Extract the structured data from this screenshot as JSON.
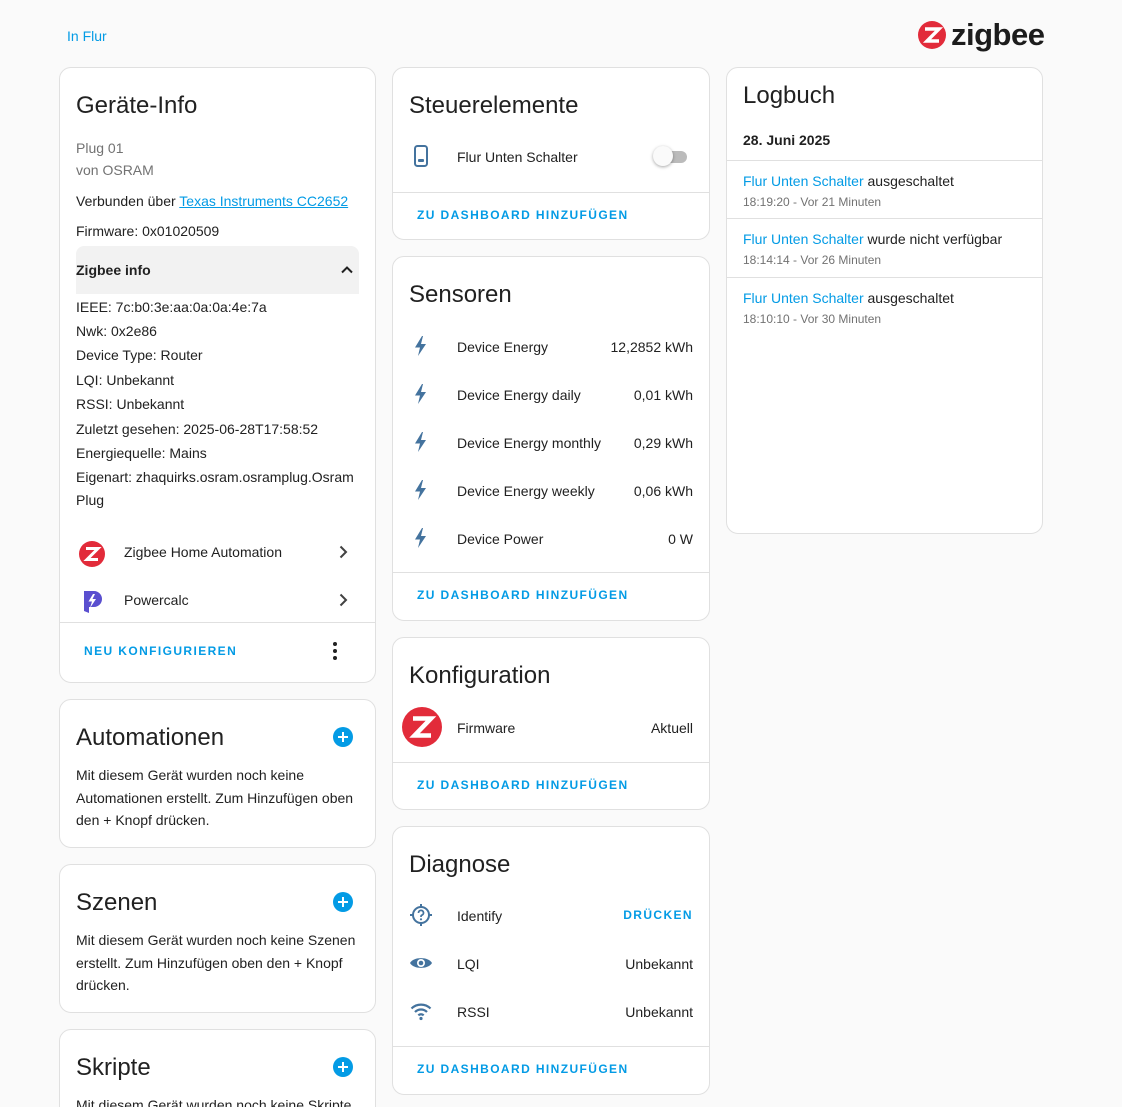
{
  "breadcrumb": {
    "area": "In Flur"
  },
  "brand": {
    "name": "zigbee",
    "color": "#e22b3a"
  },
  "device_info": {
    "title": "Geräte-Info",
    "model": "Plug 01",
    "manufacturer": "von OSRAM",
    "connected_prefix": "Verbunden über ",
    "connected_via": "Texas Instruments CC2652",
    "firmware": "Firmware: 0x01020509",
    "zigbee_info_title": "Zigbee info",
    "zigbee_lines": [
      "IEEE: 7c:b0:3e:aa:0a:0a:4e:7a",
      "Nwk: 0x2e86",
      "Device Type: Router",
      "LQI: Unbekannt",
      "RSSI: Unbekannt",
      "Zuletzt gesehen: 2025-06-28T17:58:52",
      "Energiequelle: Mains",
      "Eigenart: zhaquirks.osram.osramplug.Osram Plug"
    ],
    "integrations": [
      {
        "label": "Zigbee Home Automation",
        "icon": "zigbee-logo-icon"
      },
      {
        "label": "Powercalc",
        "icon": "powercalc-logo-icon"
      }
    ],
    "reconfigure_label": "NEU KONFIGURIEREN"
  },
  "automations": {
    "title": "Automationen",
    "text": "Mit diesem Gerät wurden noch keine Automationen erstellt. Zum Hinzufügen oben den + Knopf drücken."
  },
  "scenes": {
    "title": "Szenen",
    "text": "Mit diesem Gerät wurden noch keine Szenen erstellt. Zum Hinzufügen oben den + Knopf drücken."
  },
  "scripts": {
    "title": "Skripte",
    "text": "Mit diesem Gerät wurden noch keine Skripte"
  },
  "controls": {
    "title": "Steuerelemente",
    "entity_name": "Flur Unten Schalter",
    "state": "off",
    "add_label": "ZU DASHBOARD HINZUFÜGEN"
  },
  "sensors": {
    "title": "Sensoren",
    "items": [
      {
        "name": "Device Energy",
        "value": "12,2852 kWh",
        "icon": "flash-icon"
      },
      {
        "name": "Device Energy daily",
        "value": "0,01 kWh",
        "icon": "flash-icon"
      },
      {
        "name": "Device Energy monthly",
        "value": "0,29 kWh",
        "icon": "flash-icon"
      },
      {
        "name": "Device Energy weekly",
        "value": "0,06 kWh",
        "icon": "flash-icon"
      },
      {
        "name": "Device Power",
        "value": "0 W",
        "icon": "flash-icon"
      }
    ],
    "add_label": "ZU DASHBOARD HINZUFÜGEN"
  },
  "configuration": {
    "title": "Konfiguration",
    "name": "Firmware",
    "value": "Aktuell",
    "add_label": "ZU DASHBOARD HINZUFÜGEN"
  },
  "diagnostics": {
    "title": "Diagnose",
    "identify_name": "Identify",
    "identify_button": "DRÜCKEN",
    "lqi_name": "LQI",
    "lqi_value": "Unbekannt",
    "rssi_name": "RSSI",
    "rssi_value": "Unbekannt",
    "add_label": "ZU DASHBOARD HINZUFÜGEN"
  },
  "logbook": {
    "title": "Logbuch",
    "date": "28. Juni 2025",
    "entries": [
      {
        "entity": "Flur Unten Schalter",
        "message": " ausgeschaltet",
        "time": "18:19:20 - Vor 21 Minuten"
      },
      {
        "entity": "Flur Unten Schalter",
        "message": " wurde nicht verfügbar",
        "time": "18:14:14 - Vor 26 Minuten"
      },
      {
        "entity": "Flur Unten Schalter",
        "message": " ausgeschaltet",
        "time": "18:10:10 - Vor 30 Minuten"
      }
    ]
  },
  "colors": {
    "primary": "#039be5",
    "icon": "#44739e",
    "zigbee_red": "#e22b3a",
    "powercalc": "#5a4fcf"
  }
}
